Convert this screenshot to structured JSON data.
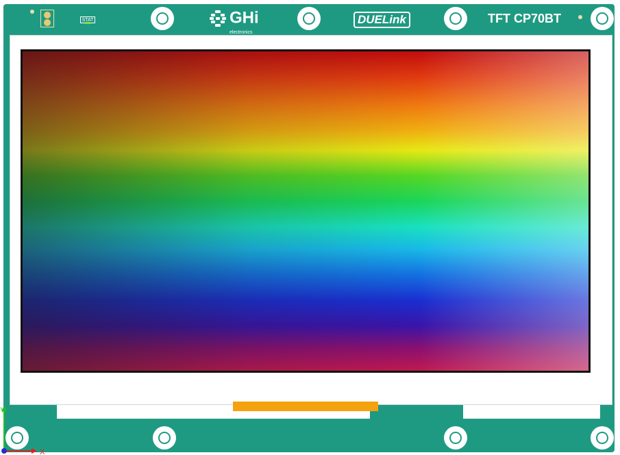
{
  "board": {
    "brand_ghi": "GHi",
    "brand_ghi_sub": "electronics",
    "brand_duelink": "DUELink",
    "model": "TFT CP70BT",
    "status_label": "STAT"
  },
  "axes": {
    "x_label": "X",
    "y_label": "Y"
  },
  "colors": {
    "pcb": "#1f9a82",
    "ribbon": "#f5a20f",
    "x_axis": "#e02020",
    "y_axis": "#20c020"
  },
  "display": {
    "content": "rainbow-gradient"
  }
}
